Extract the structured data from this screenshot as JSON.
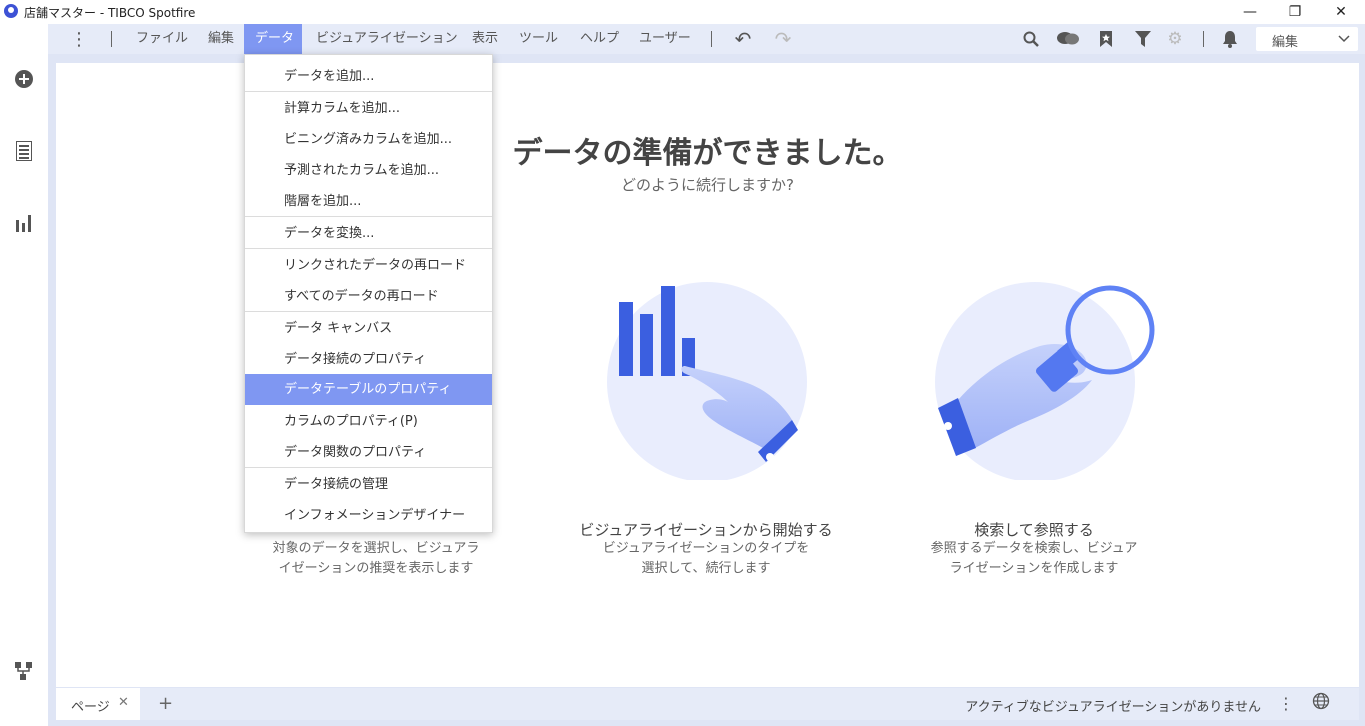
{
  "window": {
    "title": "店舗マスター - TIBCO Spotfire",
    "minimize": "—",
    "restore": "❐",
    "close": "✕"
  },
  "menubar": {
    "items": [
      "ファイル",
      "編集",
      "データ",
      "ビジュアライゼーション",
      "表示",
      "ツール",
      "ヘルプ",
      "ユーザー"
    ],
    "active_index": 2,
    "mode": "編集"
  },
  "icons": {
    "more": "⋮",
    "undo": "↶",
    "redo": "↷",
    "search": "⚲",
    "filter": "⏷",
    "settings": "⚙",
    "chevron": "⌄",
    "close": "✕",
    "add": "+",
    "plus_circle": "✚",
    "globe": "⊕"
  },
  "main": {
    "heading": "データの準備ができました。",
    "subheading": "どのように続行しますか?",
    "cards": [
      {
        "title": "",
        "desc_line1": "対象のデータを選択し、ビジュアラ",
        "desc_line2": "イゼーションの推奨を表示します"
      },
      {
        "title": "ビジュアライゼーションから開始する",
        "desc_line1": "ビジュアライゼーションのタイプを",
        "desc_line2": "選択して、続行します"
      },
      {
        "title": "検索して参照する",
        "desc_line1": "参照するデータを検索し、ビジュア",
        "desc_line2": "ライゼーションを作成します"
      }
    ]
  },
  "dropdown": {
    "items": [
      "データを追加...",
      "計算カラムを追加...",
      "ビニング済みカラムを追加...",
      "予測されたカラムを追加...",
      "階層を追加...",
      "データを変換...",
      "リンクされたデータの再ロード",
      "すべてのデータの再ロード",
      "データ キャンバス",
      "データ接続のプロパティ",
      "データテーブルのプロパティ",
      "カラムのプロパティ(P)",
      "データ関数のプロパティ",
      "データ接続の管理",
      "インフォメーションデザイナー"
    ],
    "highlighted_index": 10
  },
  "bottom": {
    "page_tab": "ページ",
    "status": "アクティブなビジュアライゼーションがありません"
  },
  "colors": {
    "accent": "#7f97f2",
    "brand": "#3d52d5"
  }
}
